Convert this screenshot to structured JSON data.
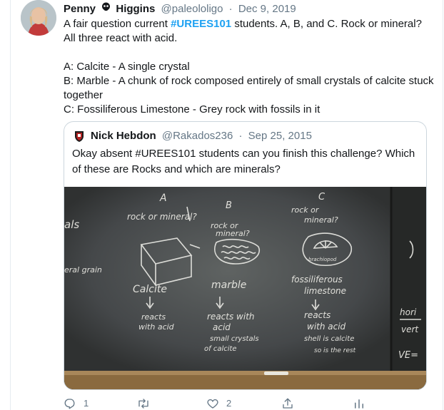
{
  "tweet": {
    "author_name": "Penny",
    "author_name_2": "Higgins",
    "handle": "@paleololigo",
    "separator": "·",
    "date": "Dec 9, 2019",
    "text_before_hashtag": "A fair question current ",
    "hashtag": "#UREES101",
    "text_after_hashtag": " students. A, B, and C. Rock or mineral? All three react with acid.",
    "line_a": "A: Calcite - A single crystal",
    "line_b": "B: Marble - A chunk of rock composed entirely of small crystals of calcite stuck together",
    "line_c": "C: Fossiliferous Limestone - Grey rock with fossils in it"
  },
  "quote": {
    "author_name": "Nick Hebdon",
    "handle": "@Rakados236",
    "separator": "·",
    "date": "Sep 25, 2015",
    "text": "Okay absent #UREES101 students can you finish this challenge? Which of these are Rocks and which are minerals?"
  },
  "chalkboard": {
    "label_a": "A",
    "label_b": "B",
    "label_c": "C",
    "q_a": "rock or mineral?",
    "q_b1": "rock or",
    "q_b2": "mineral?",
    "q_c1": "rock or",
    "q_c2": "mineral?",
    "edge_als": "als",
    "edge_grain": "eral grain",
    "name_a": "Calcite",
    "name_b": "marble",
    "name_c1": "fossiliferous",
    "name_c2": "limestone",
    "brachiopod": "brachiopod",
    "react_a1": "reacts",
    "react_a2": "with acid",
    "react_b1": "reacts with",
    "react_b2": "acid",
    "react_b3": "small crystals",
    "react_b4": "of calcite",
    "react_c1": "reacts",
    "react_c2": "with acid",
    "react_c3": "shell is calcite",
    "react_c4": "so is the rest",
    "right_1": "hori",
    "right_2": "vert",
    "right_3": "VE="
  },
  "actions": {
    "reply_count": "1",
    "retweet_count": "",
    "like_count": "2"
  }
}
